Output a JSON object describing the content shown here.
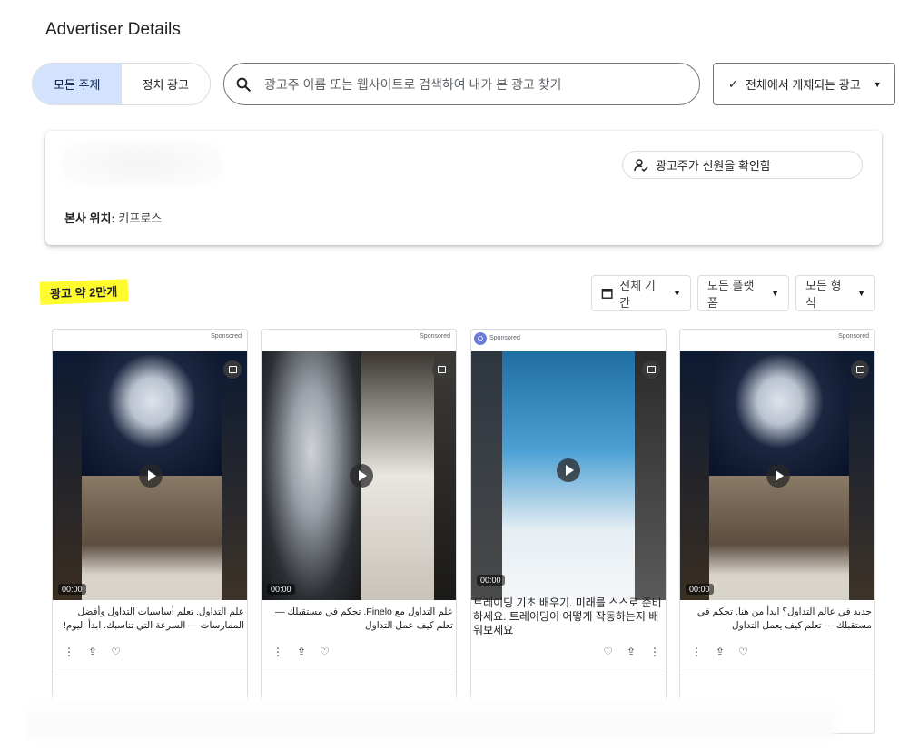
{
  "header": {
    "title": "Advertiser Details"
  },
  "topic_toggle": {
    "all": "모든 주제",
    "political": "정치 광고"
  },
  "search": {
    "placeholder": "광고주 이름 또는 웹사이트로 검색하여 내가 본 광고 찾기"
  },
  "region_button": {
    "label": "전체에서 게재되는 광고"
  },
  "advertiser": {
    "hq_label": "본사 위치:",
    "hq_value": "키프로스",
    "verify_label": "광고주가 신원을 확인함"
  },
  "results": {
    "count_label": "광고 약 2만개"
  },
  "filters": {
    "period": "전체 기간",
    "platform": "모든 플랫폼",
    "format": "모든 형식"
  },
  "ads": [
    {
      "sponsored": "Sponsored",
      "duration": "00:00",
      "caption": "علم التداول. تعلم أساسيات التداول وأفضل الممارسات — السرعة التي تناسبك. ابدأ اليوم!"
    },
    {
      "sponsored": "Sponsored",
      "duration": "00:00",
      "caption": "علم التداول مع Finelo. تحكم في مستقبلك — تعلم كيف عمل التداول"
    },
    {
      "sponsored": "Sponsored",
      "duration": "00:00",
      "caption": "트레이딩 기초 배우기. 미래를 스스로 준비하세요. 트레이딩이 어떻게 작동하는지 배워보세요",
      "advertiser_initial": "O"
    },
    {
      "sponsored": "Sponsored",
      "duration": "00:00",
      "caption": "جديد في عالم التداول؟ ابدأ من هنا. تحكم في مستقبلك — تعلم كيف يعمل التداول"
    }
  ],
  "colors": {
    "accent_toggle": "#d3e3fd",
    "highlight": "#fffb2d"
  },
  "icons": [
    "search-icon",
    "check-icon",
    "verified-user-icon",
    "calendar-icon",
    "video-icon",
    "play-icon",
    "more-icon",
    "share-icon",
    "heart-icon"
  ]
}
